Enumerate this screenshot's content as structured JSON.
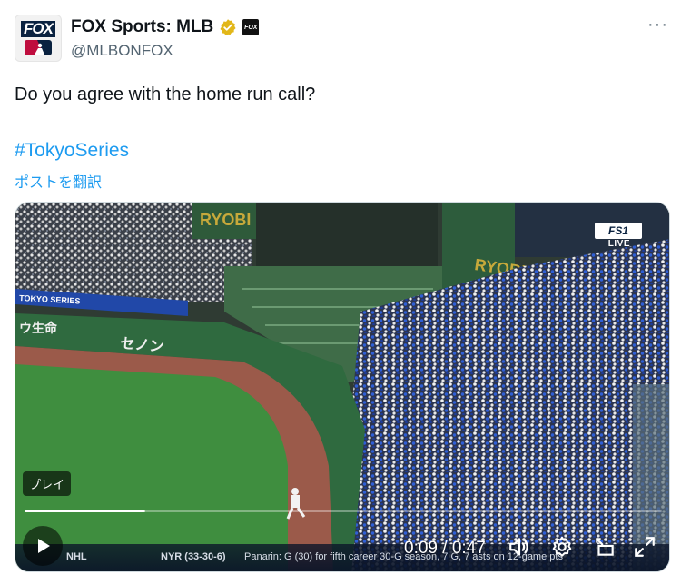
{
  "author": {
    "name": "FOX Sports: MLB",
    "handle": "@MLBONFOX",
    "avatar_text": "FOX",
    "affiliate_badge_text": "FOX"
  },
  "post": {
    "text": "Do you agree with the home run call?",
    "hashtag": "#TokyoSeries",
    "translate_label": "ポストを翻訳"
  },
  "video": {
    "network_logo": "FS1",
    "live_label": "LIVE",
    "play_label": "プレイ",
    "current_time": "0:09",
    "separator": " / ",
    "duration": "0:47",
    "progress": 0.19,
    "ticker": {
      "league": "NHL",
      "team": "NYR (33-30-6)",
      "headline": "Panarin: G (30) for fifth career 30-G season, 7 G, 7 asts on 12-game pts"
    },
    "stadium_signs": [
      "RYOBI",
      "RYOBI",
      "TOKYO SERIES",
      "ウ生命",
      "セノン"
    ]
  },
  "icons": {
    "more": "more-icon",
    "verified": "verified-badge-icon",
    "play": "play-icon",
    "volume": "volume-icon",
    "settings": "gear-icon",
    "pip": "picture-in-picture-icon",
    "fullscreen": "fullscreen-icon"
  },
  "colors": {
    "link": "#1d9bf0",
    "verified_gold": "#e2b719",
    "text": "#0f1419",
    "secondary": "#536471"
  }
}
